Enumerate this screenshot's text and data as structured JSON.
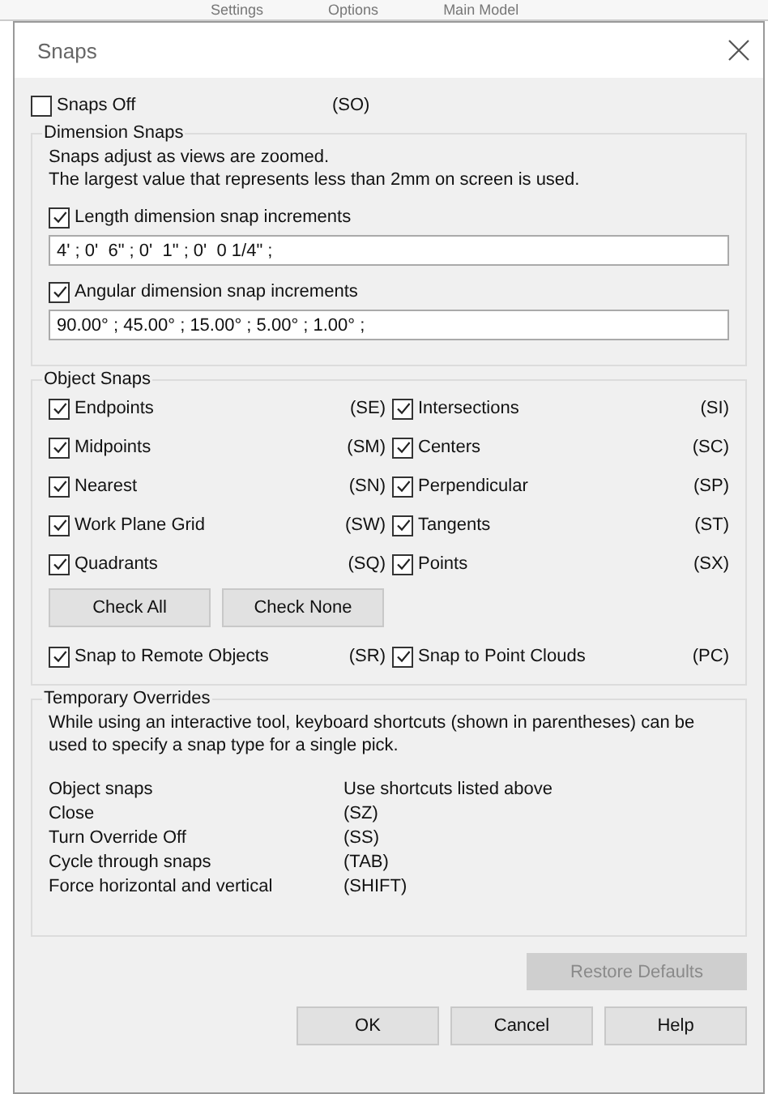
{
  "backdrop": {
    "items": [
      "Settings",
      "Options",
      "Main Model"
    ]
  },
  "window": {
    "title": "Snaps"
  },
  "snaps_off": {
    "label": "Snaps Off",
    "shortcut": "(SO)",
    "checked": false
  },
  "dimension_snaps": {
    "title": "Dimension Snaps",
    "note": "Snaps adjust as views are zoomed.\nThe largest value that represents less than 2mm on screen is used.",
    "fields": [
      {
        "label": "Length dimension snap increments",
        "checked": true,
        "value": "4' ; 0'  6\" ; 0'  1\" ; 0'  0 1/4\" ;"
      },
      {
        "label": "Angular dimension snap increments",
        "checked": true,
        "value": "90.00° ; 45.00° ; 15.00° ; 5.00° ; 1.00° ;"
      }
    ]
  },
  "object_snaps": {
    "title": "Object Snaps",
    "items": [
      {
        "label": "Endpoints",
        "shortcut": "(SE)",
        "checked": true
      },
      {
        "label": "Intersections",
        "shortcut": "(SI)",
        "checked": true
      },
      {
        "label": "Midpoints",
        "shortcut": "(SM)",
        "checked": true
      },
      {
        "label": "Centers",
        "shortcut": "(SC)",
        "checked": true
      },
      {
        "label": "Nearest",
        "shortcut": "(SN)",
        "checked": true
      },
      {
        "label": "Perpendicular",
        "shortcut": "(SP)",
        "checked": true
      },
      {
        "label": "Work Plane Grid",
        "shortcut": "(SW)",
        "checked": true
      },
      {
        "label": "Tangents",
        "shortcut": "(ST)",
        "checked": true
      },
      {
        "label": "Quadrants",
        "shortcut": "(SQ)",
        "checked": true
      },
      {
        "label": "Points",
        "shortcut": "(SX)",
        "checked": true
      }
    ],
    "buttons": [
      "Check All",
      "Check None"
    ],
    "extra_items": [
      {
        "label": "Snap to Remote Objects",
        "shortcut": "(SR)",
        "checked": true
      },
      {
        "label": "Snap to Point Clouds",
        "shortcut": "(PC)",
        "checked": true
      }
    ]
  },
  "temporary_overrides": {
    "title": "Temporary Overrides",
    "note": "While using an interactive tool, keyboard shortcuts (shown in parentheses) can be used to specify a snap type for a single pick.",
    "rows": [
      {
        "action": "Object snaps",
        "shortcut": "Use shortcuts listed above"
      },
      {
        "action": "Close",
        "shortcut": "(SZ)"
      },
      {
        "action": "Turn Override Off",
        "shortcut": "(SS)"
      },
      {
        "action": "Cycle through snaps",
        "shortcut": "(TAB)"
      },
      {
        "action": "Force horizontal and vertical",
        "shortcut": "(SHIFT)"
      }
    ]
  },
  "restore_button": {
    "label": "Restore Defaults",
    "disabled": true
  },
  "buttons": [
    "OK",
    "Cancel",
    "Help"
  ]
}
